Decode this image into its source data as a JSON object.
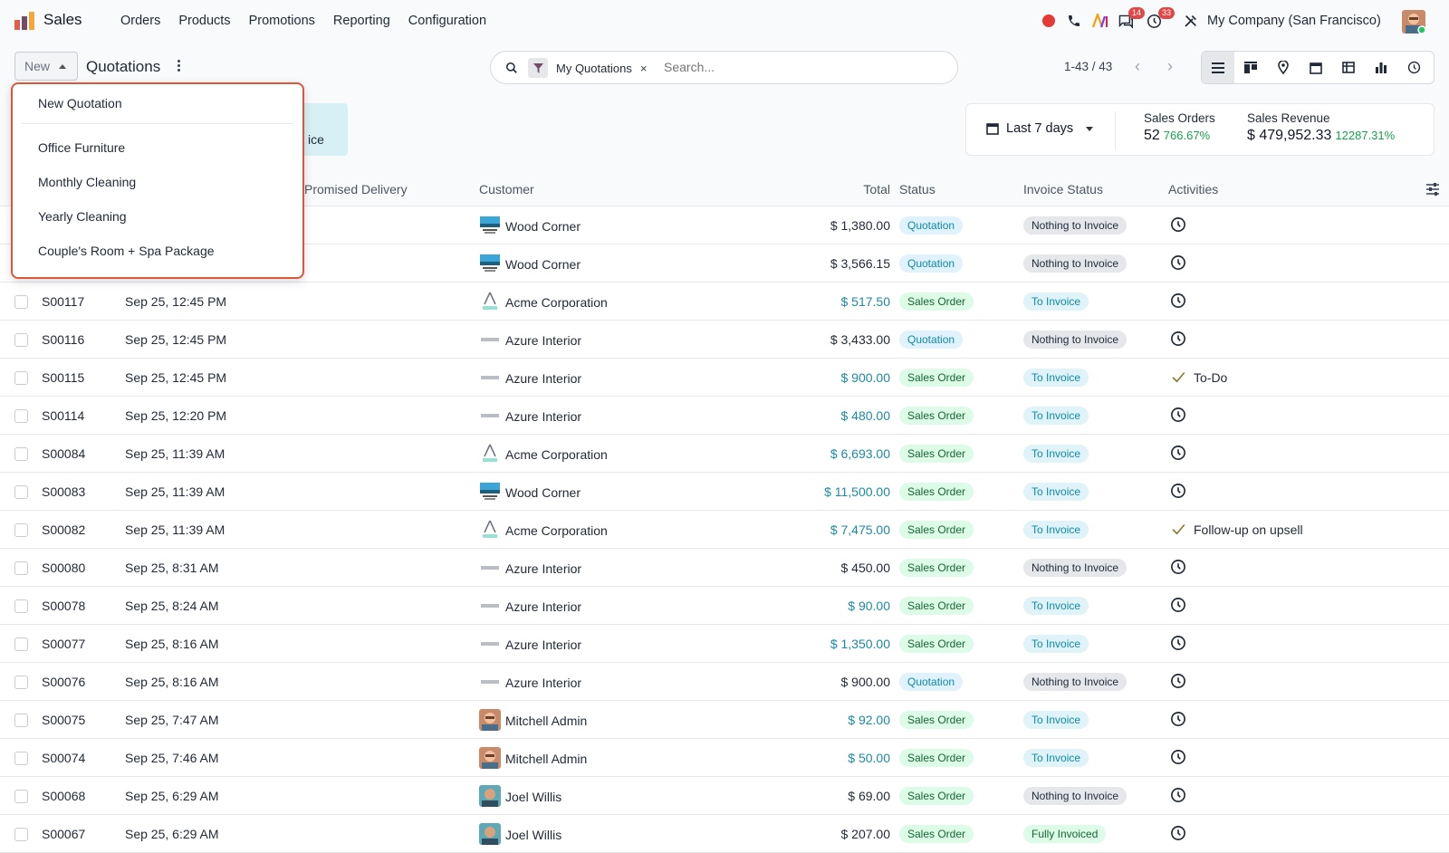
{
  "app": {
    "name": "Sales"
  },
  "menu": [
    "Orders",
    "Products",
    "Promotions",
    "Reporting",
    "Configuration"
  ],
  "systray": {
    "messages_badge": "14",
    "activities_badge": "33",
    "company": "My Company (San Francisco)"
  },
  "control": {
    "new_label": "New",
    "breadcrumb": "Quotations",
    "facet_label": "My Quotations",
    "facet_remove": "×",
    "search_placeholder": "Search...",
    "pager": "1-43 / 43",
    "ghost_text": "ice"
  },
  "stats": {
    "period": "Last 7 days",
    "orders_label": "Sales Orders",
    "orders_value": "52",
    "orders_pct": "766.67%",
    "revenue_label": "Sales Revenue",
    "revenue_value": "$ 479,952.33",
    "revenue_pct": "12287.31%"
  },
  "columns": {
    "delivery": "Promised Delivery",
    "customer": "Customer",
    "total": "Total",
    "status": "Status",
    "invoice_status": "Invoice Status",
    "activities": "Activities"
  },
  "dropdown": [
    "New Quotation",
    "Office Furniture",
    "Monthly Cleaning",
    "Yearly Cleaning",
    "Couple's Room + Spa Package"
  ],
  "rows": [
    {
      "num": "",
      "date": "",
      "logo": "wood",
      "customer": "Wood Corner",
      "total": "$ 1,380.00",
      "link": false,
      "status": "Quotation",
      "scls": "quote",
      "inv": "Nothing to Invoice",
      "icls": "nothing",
      "act": ""
    },
    {
      "num": "",
      "date": "",
      "logo": "wood",
      "customer": "Wood Corner",
      "total": "$ 3,566.15",
      "link": false,
      "status": "Quotation",
      "scls": "quote",
      "inv": "Nothing to Invoice",
      "icls": "nothing",
      "act": ""
    },
    {
      "num": "S00117",
      "date": "Sep 25, 12:45 PM",
      "logo": "acme",
      "customer": "Acme Corporation",
      "total": "$ 517.50",
      "link": true,
      "status": "Sales Order",
      "scls": "so",
      "inv": "To Invoice",
      "icls": "toinv",
      "act": ""
    },
    {
      "num": "S00116",
      "date": "Sep 25, 12:45 PM",
      "logo": "azure",
      "customer": "Azure Interior",
      "total": "$ 3,433.00",
      "link": false,
      "status": "Quotation",
      "scls": "quote",
      "inv": "Nothing to Invoice",
      "icls": "nothing",
      "act": ""
    },
    {
      "num": "S00115",
      "date": "Sep 25, 12:45 PM",
      "logo": "azure",
      "customer": "Azure Interior",
      "total": "$ 900.00",
      "link": true,
      "status": "Sales Order",
      "scls": "so",
      "inv": "To Invoice",
      "icls": "toinv",
      "act": "To-Do"
    },
    {
      "num": "S00114",
      "date": "Sep 25, 12:20 PM",
      "logo": "azure",
      "customer": "Azure Interior",
      "total": "$ 480.00",
      "link": true,
      "status": "Sales Order",
      "scls": "so",
      "inv": "To Invoice",
      "icls": "toinv",
      "act": ""
    },
    {
      "num": "S00084",
      "date": "Sep 25, 11:39 AM",
      "logo": "acme",
      "customer": "Acme Corporation",
      "total": "$ 6,693.00",
      "link": true,
      "status": "Sales Order",
      "scls": "so",
      "inv": "To Invoice",
      "icls": "toinv",
      "act": ""
    },
    {
      "num": "S00083",
      "date": "Sep 25, 11:39 AM",
      "logo": "wood",
      "customer": "Wood Corner",
      "total": "$ 11,500.00",
      "link": true,
      "status": "Sales Order",
      "scls": "so",
      "inv": "To Invoice",
      "icls": "toinv",
      "act": ""
    },
    {
      "num": "S00082",
      "date": "Sep 25, 11:39 AM",
      "logo": "acme",
      "customer": "Acme Corporation",
      "total": "$ 7,475.00",
      "link": true,
      "status": "Sales Order",
      "scls": "so",
      "inv": "To Invoice",
      "icls": "toinv",
      "act": "Follow-up on upsell"
    },
    {
      "num": "S00080",
      "date": "Sep 25, 8:31 AM",
      "logo": "azure",
      "customer": "Azure Interior",
      "total": "$ 450.00",
      "link": false,
      "status": "Sales Order",
      "scls": "so",
      "inv": "Nothing to Invoice",
      "icls": "nothing",
      "act": ""
    },
    {
      "num": "S00078",
      "date": "Sep 25, 8:24 AM",
      "logo": "azure",
      "customer": "Azure Interior",
      "total": "$ 90.00",
      "link": true,
      "status": "Sales Order",
      "scls": "so",
      "inv": "To Invoice",
      "icls": "toinv",
      "act": ""
    },
    {
      "num": "S00077",
      "date": "Sep 25, 8:16 AM",
      "logo": "azure",
      "customer": "Azure Interior",
      "total": "$ 1,350.00",
      "link": true,
      "status": "Sales Order",
      "scls": "so",
      "inv": "To Invoice",
      "icls": "toinv",
      "act": ""
    },
    {
      "num": "S00076",
      "date": "Sep 25, 8:16 AM",
      "logo": "azure",
      "customer": "Azure Interior",
      "total": "$ 900.00",
      "link": false,
      "status": "Quotation",
      "scls": "quote",
      "inv": "Nothing to Invoice",
      "icls": "nothing",
      "act": ""
    },
    {
      "num": "S00075",
      "date": "Sep 25, 7:47 AM",
      "logo": "mitchell",
      "customer": "Mitchell Admin",
      "total": "$ 92.00",
      "link": true,
      "status": "Sales Order",
      "scls": "so",
      "inv": "To Invoice",
      "icls": "toinv",
      "act": ""
    },
    {
      "num": "S00074",
      "date": "Sep 25, 7:46 AM",
      "logo": "mitchell",
      "customer": "Mitchell Admin",
      "total": "$ 50.00",
      "link": true,
      "status": "Sales Order",
      "scls": "so",
      "inv": "To Invoice",
      "icls": "toinv",
      "act": ""
    },
    {
      "num": "S00068",
      "date": "Sep 25, 6:29 AM",
      "logo": "joel",
      "customer": "Joel Willis",
      "total": "$ 69.00",
      "link": false,
      "status": "Sales Order",
      "scls": "so",
      "inv": "Nothing to Invoice",
      "icls": "nothing",
      "act": ""
    },
    {
      "num": "S00067",
      "date": "Sep 25, 6:29 AM",
      "logo": "joel",
      "customer": "Joel Willis",
      "total": "$ 207.00",
      "link": false,
      "status": "Sales Order",
      "scls": "so",
      "inv": "Fully Invoiced",
      "icls": "fully",
      "act": ""
    }
  ]
}
